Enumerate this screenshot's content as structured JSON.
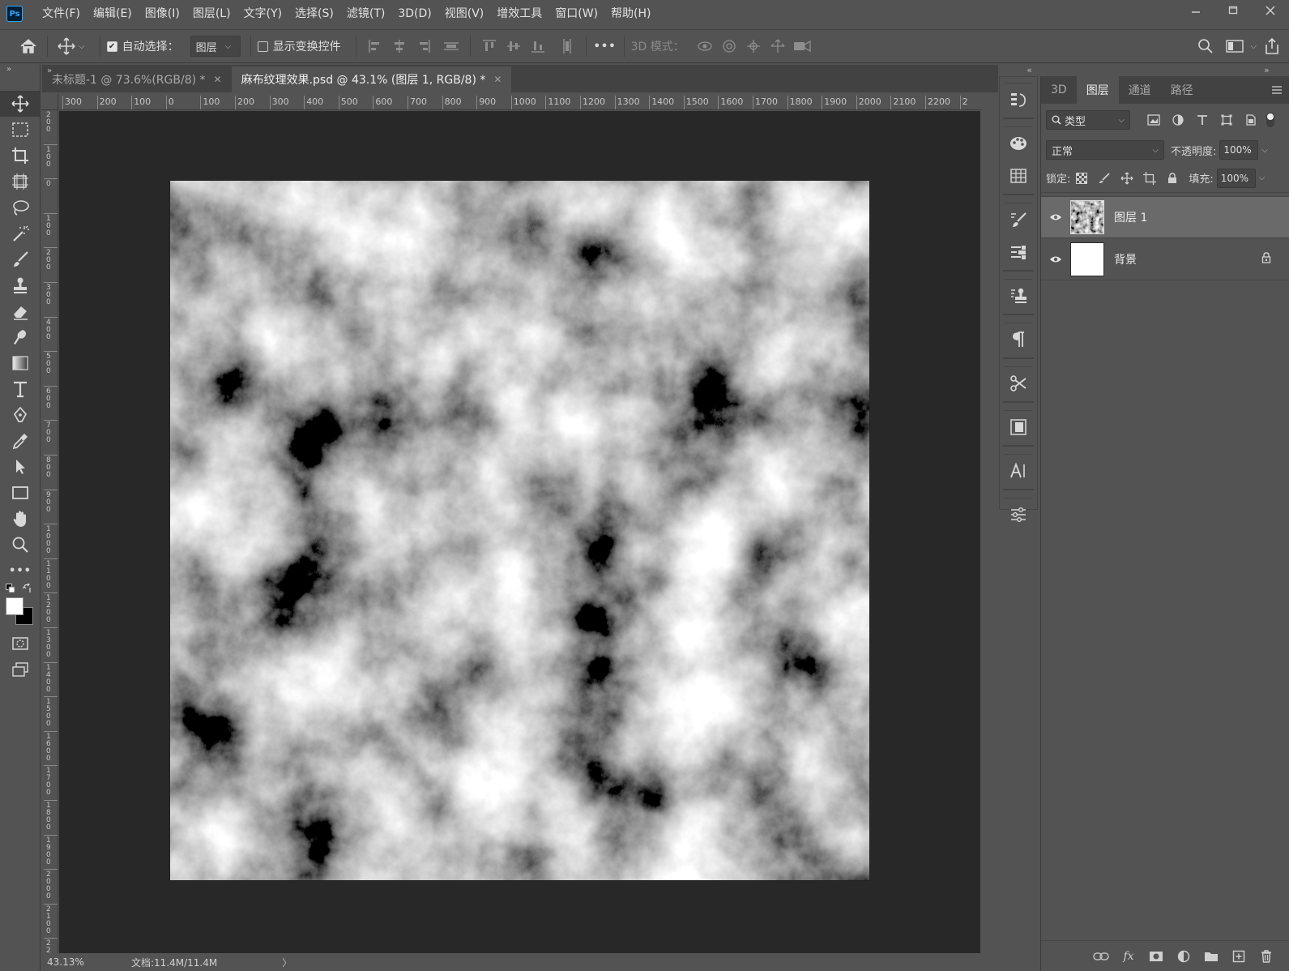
{
  "app": {
    "logo": "Ps"
  },
  "menu": [
    "文件(F)",
    "编辑(E)",
    "图像(I)",
    "图层(L)",
    "文字(Y)",
    "选择(S)",
    "滤镜(T)",
    "3D(D)",
    "视图(V)",
    "增效工具",
    "窗口(W)",
    "帮助(H)"
  ],
  "options": {
    "auto_select_label": "自动选择：",
    "auto_select_checked": true,
    "auto_select_target": "图层",
    "transform_controls_label": "显示变换控件",
    "transform_controls_checked": false,
    "more": "•••",
    "mode_3d_label": "3D 模式："
  },
  "tabs": [
    {
      "label": "未标题-1 @ 73.6%(RGB/8) *",
      "active": false
    },
    {
      "label": "麻布纹理效果.psd @ 43.1% (图层 1, RGB/8) *",
      "active": true
    }
  ],
  "ruler": {
    "h": [
      "300",
      "200",
      "100",
      "0",
      "100",
      "200",
      "300",
      "400",
      "500",
      "600",
      "700",
      "800",
      "900",
      "1000",
      "1100",
      "1200",
      "1300",
      "1400",
      "1500",
      "1600",
      "1700",
      "1800",
      "1900",
      "2000",
      "2100",
      "2200",
      "2"
    ],
    "v": [
      "2 0 0",
      "1 0 0",
      "0",
      "1 0 0",
      "2 0 0",
      "3 0 0",
      "4 0 0",
      "5 0 0",
      "6 0 0",
      "7 0 0",
      "8 0 0",
      "9 0 0",
      "1 0 0 0",
      "1 1 0 0",
      "1 2 0 0",
      "1 3 0 0",
      "1 4 0 0",
      "1 5 0 0",
      "1 6 0 0",
      "1 7 0 0",
      "1 8 0 0",
      "1 9 0 0",
      "2 0 0 0",
      "2 1 0 0",
      "2 2 0 0"
    ]
  },
  "status": {
    "zoom": "43.13%",
    "doc_size": "文档:11.4M/11.4M",
    "arrow": "〉"
  },
  "layers_panel": {
    "tabs": [
      "3D",
      "图层",
      "通道",
      "路径"
    ],
    "active_tab": "图层",
    "filter_kind": "类型",
    "blend_mode": "正常",
    "opacity_label": "不透明度:",
    "opacity_value": "100%",
    "lock_label": "锁定:",
    "fill_label": "填充:",
    "fill_value": "100%",
    "layers": [
      {
        "name": "图层 1",
        "selected": true,
        "locked": false
      },
      {
        "name": "背景",
        "selected": false,
        "locked": true
      }
    ],
    "footer_fx": "fx"
  },
  "colors": {
    "foreground": "#ffffff",
    "background": "#000000",
    "accent": "#31a8ff"
  }
}
